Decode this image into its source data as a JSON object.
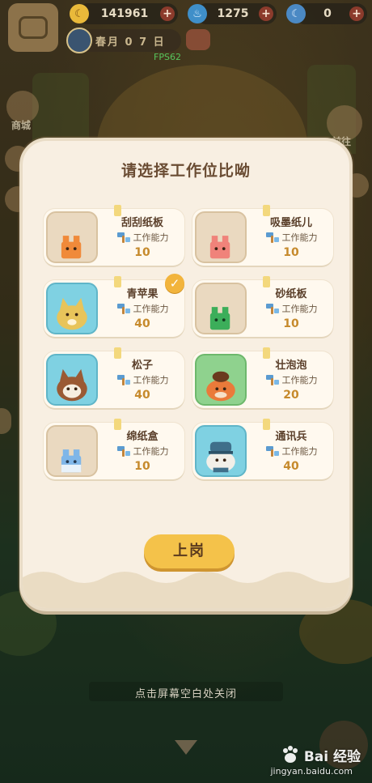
{
  "resources": {
    "bananas": {
      "icon": "banana-icon",
      "value": "141961"
    },
    "fire": {
      "icon": "flame-icon",
      "value": "1275"
    },
    "special": {
      "icon": "banana-blue-icon",
      "value": "0"
    }
  },
  "date_label": "春月 0 7 日",
  "fps": "FPS62",
  "modal": {
    "title": "请选择工作位比呦",
    "ability_label": "工作能力",
    "submit_label": "上岗",
    "workers": [
      {
        "name": "刮刮纸板",
        "ability": "10",
        "portrait": "tan",
        "character": "orange-box",
        "selected": false
      },
      {
        "name": "吸墨纸儿",
        "ability": "10",
        "portrait": "tan",
        "character": "pink-box",
        "selected": false
      },
      {
        "name": "青苹果",
        "ability": "40",
        "portrait": "blue",
        "character": "yellow-cat",
        "selected": true
      },
      {
        "name": "砂纸板",
        "ability": "10",
        "portrait": "tan",
        "character": "green-box",
        "selected": false
      },
      {
        "name": "松子",
        "ability": "40",
        "portrait": "blue",
        "character": "brown-cat",
        "selected": false
      },
      {
        "name": "壮泡泡",
        "ability": "20",
        "portrait": "green",
        "character": "orange-cat",
        "selected": false
      },
      {
        "name": "绵纸盒",
        "ability": "10",
        "portrait": "tan",
        "character": "blue-box",
        "selected": false
      },
      {
        "name": "通讯兵",
        "ability": "40",
        "portrait": "blue",
        "character": "soldier-cat",
        "selected": false
      }
    ]
  },
  "close_hint": "点击屏幕空白处关闭",
  "watermark": {
    "brand": "Bai 经验",
    "url": "jingyan.baidu.com"
  },
  "side_labels": {
    "left_top": "商城",
    "right_top": "前往"
  },
  "colors": {
    "accent": "#f4c24a",
    "title": "#6a4c33",
    "value": "#c68a2c"
  }
}
